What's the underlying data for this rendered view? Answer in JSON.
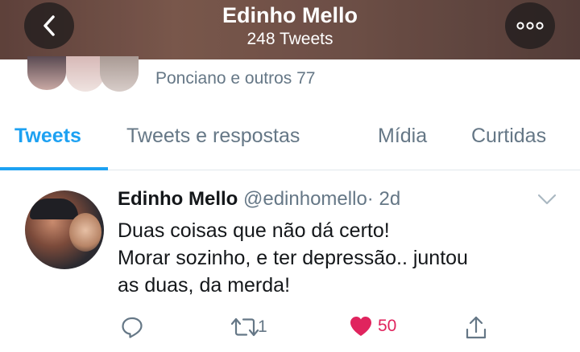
{
  "header": {
    "title": "Edinho Mello",
    "subtitle": "248 Tweets",
    "back_icon": "chevron-left-icon",
    "more_icon": "more-horizontal-icon"
  },
  "followers": {
    "text": "Ponciano e outros 77"
  },
  "tabs": [
    {
      "label": "Tweets",
      "active": true
    },
    {
      "label": "Tweets e respostas",
      "active": false
    },
    {
      "label": "Mídia",
      "active": false
    },
    {
      "label": "Curtidas",
      "active": false
    }
  ],
  "tweet": {
    "name": "Edinho Mello",
    "handle": "@edinhomello",
    "separator": "·",
    "time": "2d",
    "lines": [
      "Duas coisas que não dá certo!",
      "Morar sozinho, e ter depressão.. juntou",
      "as duas, da merda!"
    ],
    "actions": {
      "reply_count": "",
      "retweet_count": "1",
      "like_count": "50",
      "like_active": true
    }
  },
  "colors": {
    "accent": "#1da1f2",
    "muted": "#657786",
    "like": "#e0245e",
    "text": "#14171a"
  }
}
